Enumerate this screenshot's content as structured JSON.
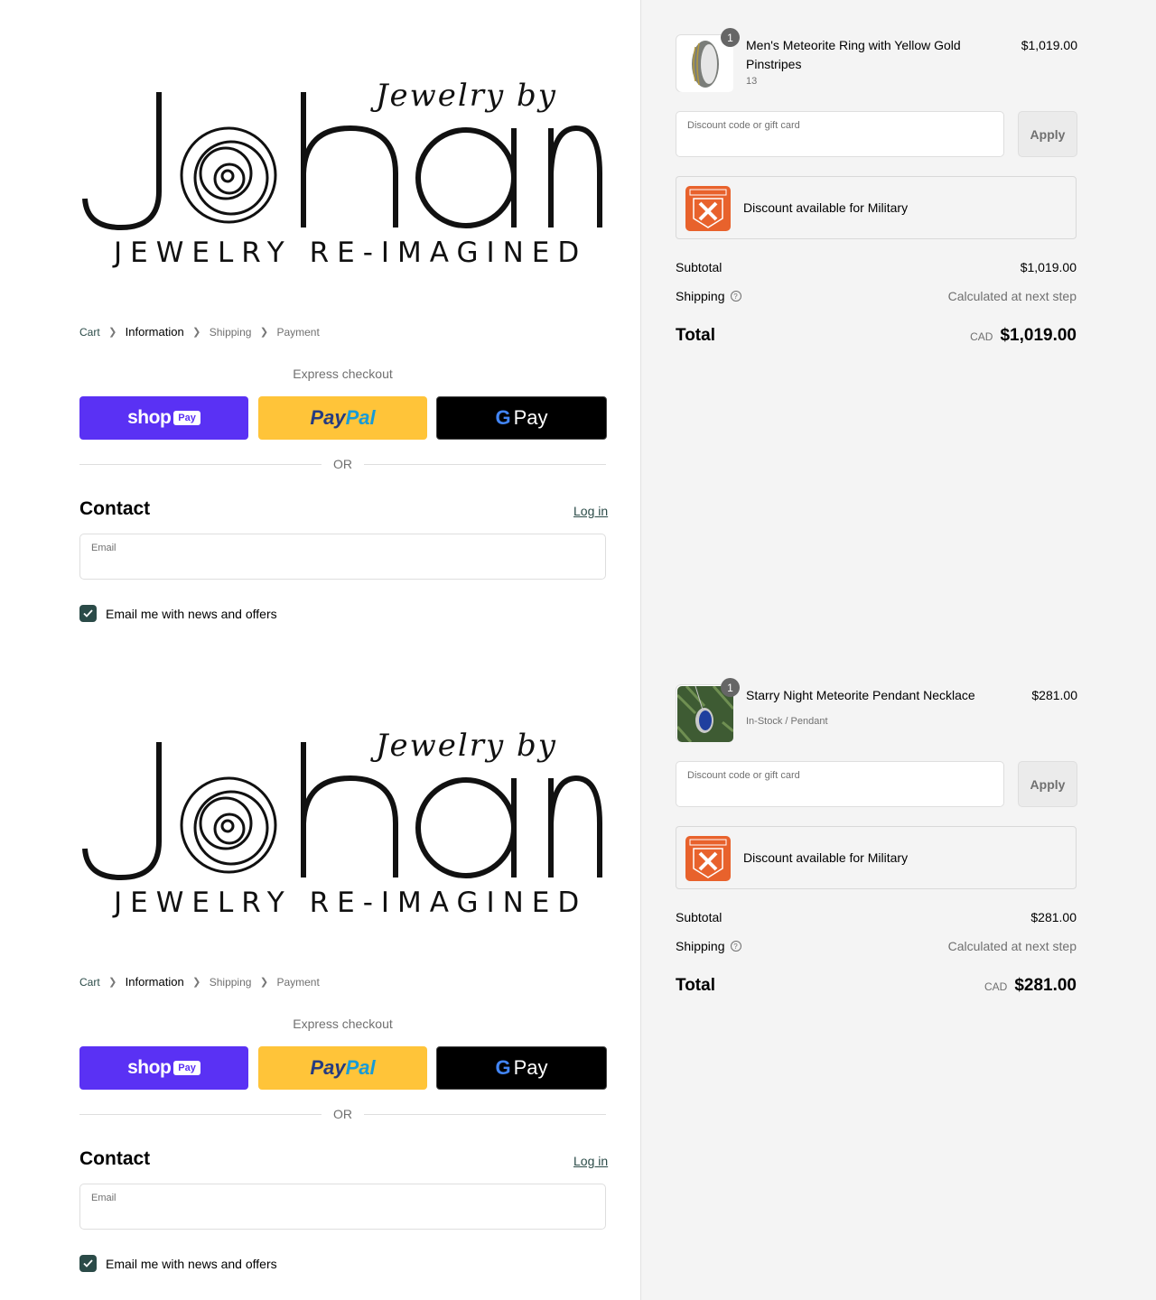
{
  "brand": {
    "logo_script": "Jewelry by",
    "logo_main": "Johan",
    "logo_tagline": "JEWELRY RE-IMAGINED"
  },
  "breadcrumb": [
    "Cart",
    "Information",
    "Shipping",
    "Payment"
  ],
  "express": {
    "title": "Express checkout",
    "shop_word": "shop",
    "shop_pay": "Pay",
    "paypal_a": "Pay",
    "paypal_b": "Pal",
    "gpay_g": "G",
    "gpay_pay": "Pay",
    "or": "OR"
  },
  "contact": {
    "title": "Contact",
    "login": "Log in",
    "email_label": "Email",
    "news_label": "Email me with news and offers",
    "news_checked": true
  },
  "orders": [
    {
      "qty": "1",
      "name": "Men's Meteorite Ring with Yellow Gold Pinstripes",
      "variant": "13",
      "price": "$1,019.00",
      "discount_label": "Discount code or gift card",
      "apply": "Apply",
      "military": "Discount available for Military",
      "subtotal_label": "Subtotal",
      "subtotal": "$1,019.00",
      "shipping_label": "Shipping",
      "shipping": "Calculated at next step",
      "total_label": "Total",
      "currency": "CAD",
      "total": "$1,019.00"
    },
    {
      "qty": "1",
      "name": "Starry Night Meteorite Pendant Necklace",
      "variant": "In-Stock / Pendant",
      "price": "$281.00",
      "discount_label": "Discount code or gift card",
      "apply": "Apply",
      "military": "Discount available for Military",
      "subtotal_label": "Subtotal",
      "subtotal": "$281.00",
      "shipping_label": "Shipping",
      "shipping": "Calculated at next step",
      "total_label": "Total",
      "currency": "CAD",
      "total": "$281.00"
    }
  ],
  "colors": {
    "accent": "#2b4b48",
    "shop_pay": "#5a31f4",
    "paypal": "#ffc439",
    "idme": "#e8622c"
  }
}
